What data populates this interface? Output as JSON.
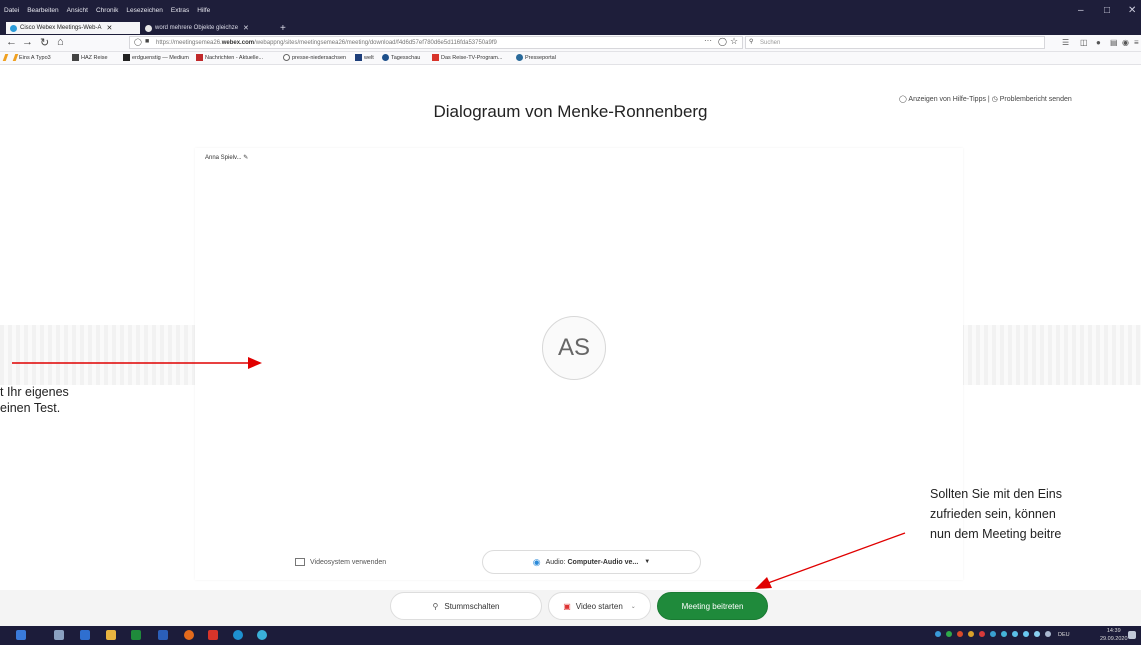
{
  "browser": {
    "menu": [
      "Datei",
      "Bearbeiten",
      "Ansicht",
      "Chronik",
      "Lesezeichen",
      "Extras",
      "Hilfe"
    ],
    "tabs": [
      {
        "label": "Cisco Webex Meetings-Web-A",
        "active": true
      },
      {
        "label": "word mehrere Objekte gleichze",
        "active": false
      }
    ],
    "url_prefix": "https://meetingsemea26.",
    "url_domain": "webex.com",
    "url_rest": "/webappng/sites/meetingsemea26/meeting/download/f4d6d57ef780d6e5d116fda53750a9f9",
    "url_more": "···",
    "search_placeholder": "Suchen",
    "bookmarks": [
      {
        "label": "Eins A Typo3",
        "color": "#f0a020"
      },
      {
        "label": "HAZ Reise",
        "color": "#444444"
      },
      {
        "label": "erdguenstig — Medium",
        "color": "#222222"
      },
      {
        "label": "Nachrichten - Aktuelle...",
        "color": "#c0282a"
      },
      {
        "label": "presse-niedersachsen",
        "color": "#666666"
      },
      {
        "label": "welt",
        "color": "#1d3e7a"
      },
      {
        "label": "Tagesschau",
        "color": "#1d4f8a"
      },
      {
        "label": "Das Reise-TV-Program...",
        "color": "#d8342a"
      },
      {
        "label": "Presseportal",
        "color": "#2a6a9a"
      }
    ]
  },
  "meeting": {
    "title": "Dialograum von Menke-Ronnenberg",
    "help_tips": "Anzeigen von Hilfe-Tipps",
    "separator": "|",
    "report": "Problembericht senden",
    "participant_name": "Anna Spielv...",
    "initials": "AS",
    "video_system": "Videosystem verwenden",
    "audio_label": "Audio:",
    "audio_value": "Computer-Audio ve...",
    "mute": "Stummschalten",
    "start_video": "Video starten",
    "join": "Meeting beitreten"
  },
  "annotations": {
    "left_line1": "t Ihr eigenes",
    "left_line2": "einen Test.",
    "right_line1": "Sollten Sie mit den Eins",
    "right_line2": "zufrieden sein, können",
    "right_line3": "nun dem Meeting beitre"
  },
  "taskbar": {
    "lang": "DEU",
    "time": "14:39",
    "date": "29.09.2020"
  },
  "colors": {
    "join_green": "#1f8a3b",
    "arrow_red": "#e00000",
    "titlebar": "#1e1e3a"
  }
}
